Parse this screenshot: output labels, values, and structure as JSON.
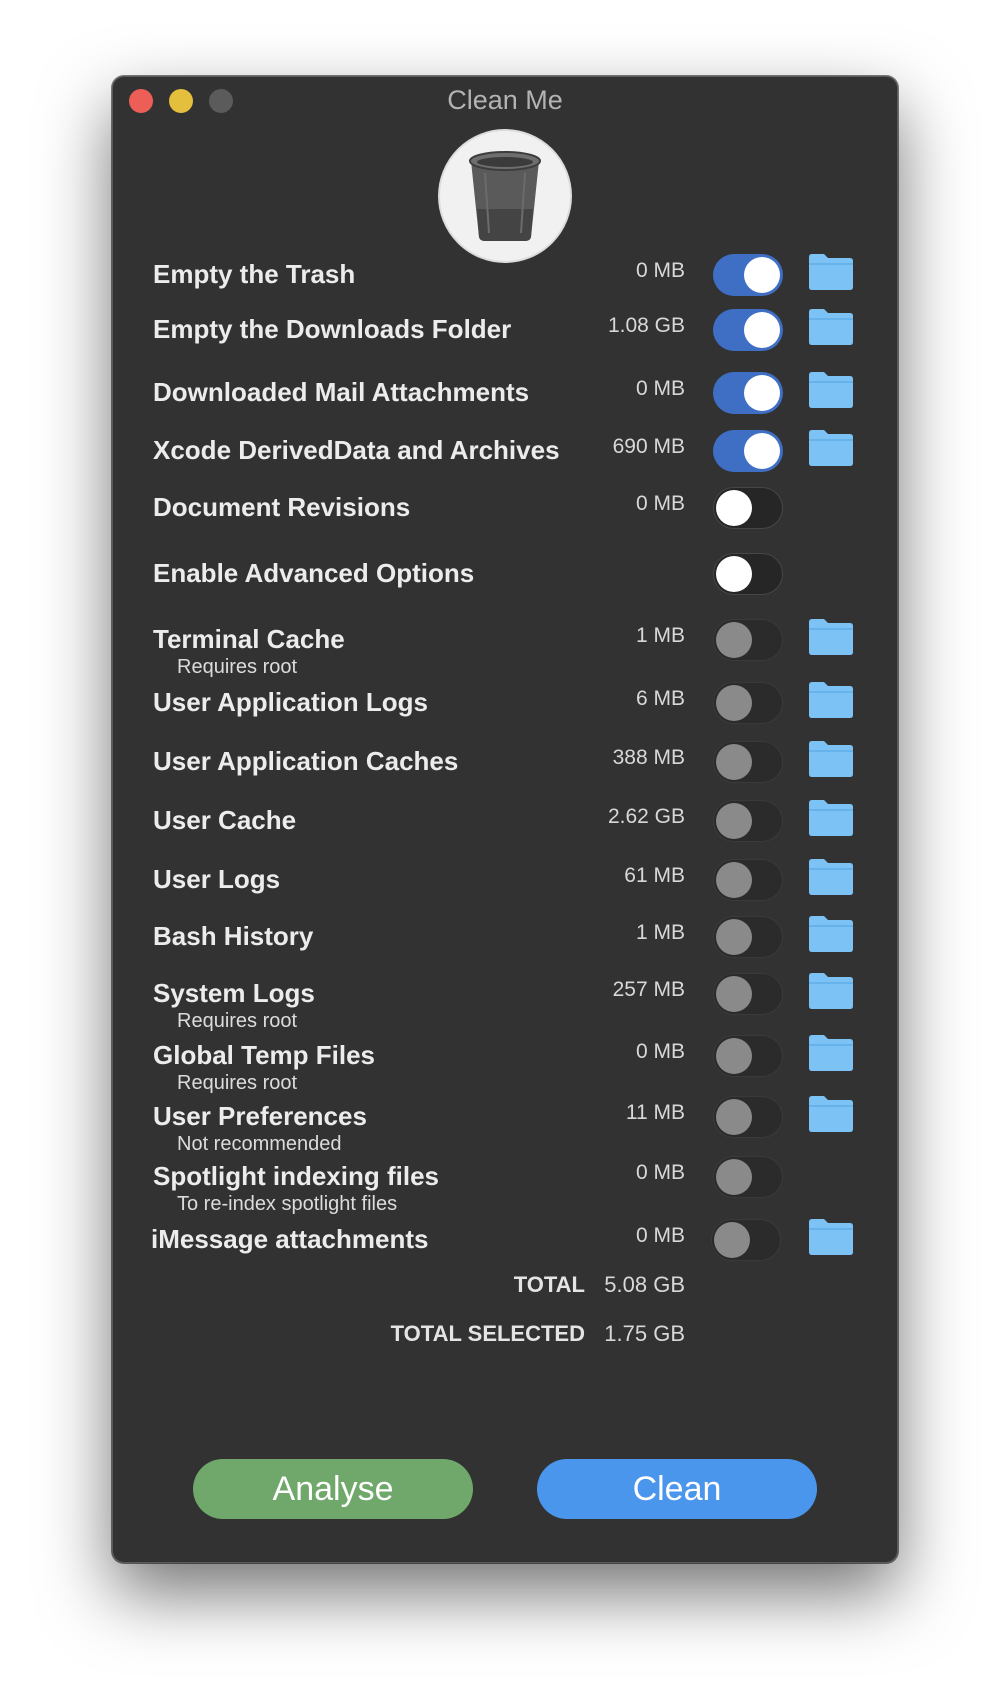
{
  "window": {
    "title": "Clean Me"
  },
  "header_icon": "trash-can-icon",
  "colors": {
    "toggle_on": "#3f6fc4",
    "folder": "#7cc2f4",
    "analyse_button": "#6fa86a",
    "clean_button": "#4a96ec"
  },
  "items": [
    {
      "label": "Empty the Trash",
      "sub": "",
      "size": "0 MB",
      "enabled": true
    },
    {
      "label": "Empty the Downloads Folder",
      "sub": "",
      "size": "1.08 GB",
      "enabled": true
    },
    {
      "label": "Downloaded Mail Attachments",
      "sub": "",
      "size": "0 MB",
      "enabled": true
    },
    {
      "label": "Xcode DerivedData and Archives",
      "sub": "",
      "size": "690 MB",
      "enabled": true
    },
    {
      "label": "Document Revisions",
      "sub": "",
      "size": "0 MB",
      "enabled": false
    },
    {
      "label": "Enable Advanced Options",
      "sub": "",
      "size": "",
      "enabled": false
    },
    {
      "label": "Terminal Cache",
      "sub": "Requires root",
      "size": "1 MB",
      "enabled": false
    },
    {
      "label": "User Application Logs",
      "sub": "",
      "size": "6 MB",
      "enabled": false
    },
    {
      "label": "User Application Caches",
      "sub": "",
      "size": "388 MB",
      "enabled": false
    },
    {
      "label": "User Cache",
      "sub": "",
      "size": "2.62 GB",
      "enabled": false
    },
    {
      "label": "User Logs",
      "sub": "",
      "size": "61 MB",
      "enabled": false
    },
    {
      "label": "Bash History",
      "sub": "",
      "size": "1 MB",
      "enabled": false
    },
    {
      "label": "System Logs",
      "sub": "Requires root",
      "size": "257 MB",
      "enabled": false
    },
    {
      "label": "Global Temp Files",
      "sub": "Requires root",
      "size": "0 MB",
      "enabled": false
    },
    {
      "label": "User Preferences",
      "sub": "Not recommended",
      "size": "11 MB",
      "enabled": false
    },
    {
      "label": "Spotlight indexing files",
      "sub": "To re-index spotlight files",
      "size": "0 MB",
      "enabled": false
    },
    {
      "label": "iMessage attachments",
      "sub": "",
      "size": "0 MB",
      "enabled": false
    }
  ],
  "totals": {
    "total_label": "TOTAL",
    "total_value": "5.08 GB",
    "selected_label": "TOTAL SELECTED",
    "selected_value": "1.75 GB"
  },
  "buttons": {
    "analyse": "Analyse",
    "clean": "Clean"
  }
}
